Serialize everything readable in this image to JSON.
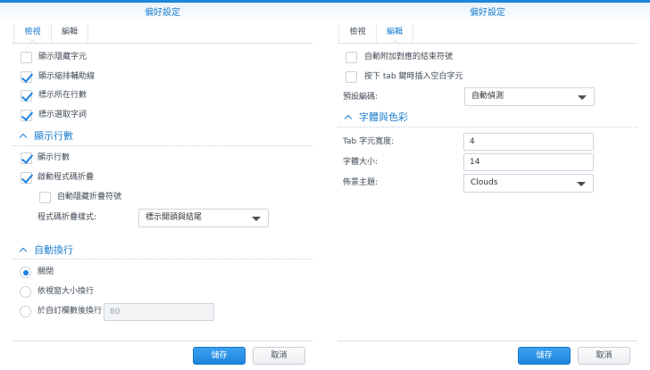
{
  "left": {
    "title": "偏好設定",
    "tabs": [
      {
        "label": "檢視",
        "active": true
      },
      {
        "label": "編輯",
        "active": false
      }
    ],
    "options": [
      {
        "label": "顯示隱藏字元",
        "checked": false
      },
      {
        "label": "顯示縮排輔助線",
        "checked": true
      },
      {
        "label": "標示所在行數",
        "checked": true
      },
      {
        "label": "標示選取字詞",
        "checked": true
      }
    ],
    "line_numbers": {
      "title": "顯示行數",
      "show_line_numbers": {
        "label": "顯示行數",
        "checked": true
      },
      "code_folding": {
        "label": "啟動程式碼折疊",
        "checked": true
      },
      "auto_hide_fold": {
        "label": "自動隱藏折疊符號",
        "checked": false
      },
      "fold_style_label": "程式碼折疊樣式:",
      "fold_style_value": "標示開頭與結尾"
    },
    "word_wrap": {
      "title": "自動換行",
      "options": [
        {
          "label": "關閉",
          "selected": true
        },
        {
          "label": "依視窗大小換行",
          "selected": false
        },
        {
          "label": "於自訂欄數後換行",
          "selected": false
        }
      ],
      "column_value": "80"
    },
    "save": "儲存",
    "cancel": "取消"
  },
  "right": {
    "title": "偏好設定",
    "tabs": [
      {
        "label": "檢視",
        "active": false
      },
      {
        "label": "編輯",
        "active": true
      }
    ],
    "options": [
      {
        "label": "自動附加對應的結束符號",
        "checked": false
      },
      {
        "label": "按下 tab 鍵時插入空白字元",
        "checked": false
      }
    ],
    "encoding_label": "預設編碼:",
    "encoding_value": "自動偵測",
    "font": {
      "title": "字體與色彩",
      "tab_width_label": "Tab 字元寬度:",
      "tab_width_value": "4",
      "font_size_label": "字體大小:",
      "font_size_value": "14",
      "theme_label": "佈景主題:",
      "theme_value": "Clouds"
    },
    "save": "儲存",
    "cancel": "取消"
  },
  "colors": {
    "accent": "#1d7fd0",
    "check": "#1a82e2"
  }
}
